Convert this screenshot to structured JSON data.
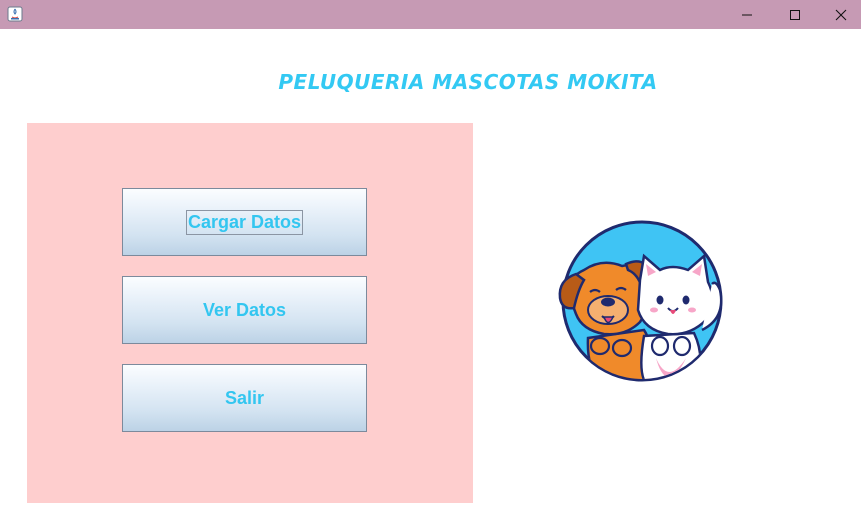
{
  "window": {
    "title": "",
    "controls": {
      "minimize_icon": "minimize-icon",
      "maximize_icon": "maximize-icon",
      "close_icon": "close-icon"
    }
  },
  "header": {
    "title": "PELUQUERIA MASCOTAS MOKITA"
  },
  "menu": {
    "buttons": [
      {
        "label": "Cargar Datos",
        "focused": true
      },
      {
        "label": "Ver Datos",
        "focused": false
      },
      {
        "label": "Salir",
        "focused": false
      }
    ]
  },
  "logo": {
    "icon": "dog-and-cat-logo"
  },
  "colors": {
    "titlebar": "#c69ab4",
    "panel": "#fecece",
    "accent_text": "#33c9f3",
    "logo_circle": "#3fc4f4",
    "logo_outline": "#1f2a6e"
  }
}
